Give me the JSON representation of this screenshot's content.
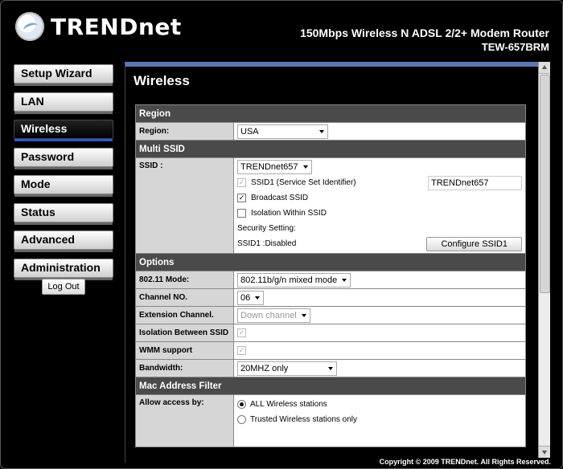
{
  "brand": {
    "name": "TRENDnet"
  },
  "product": {
    "title": "150Mbps Wireless N ADSL 2/2+ Modem Router",
    "model": "TEW-657BRM"
  },
  "nav": {
    "items": [
      "Setup Wizard",
      "LAN",
      "Wireless",
      "Password",
      "Mode",
      "Status",
      "Advanced",
      "Administration"
    ],
    "active": "Wireless",
    "logout": "Log Out"
  },
  "page": {
    "title": "Wireless"
  },
  "region": {
    "header": "Region",
    "label": "Region:",
    "value": "USA"
  },
  "multi_ssid": {
    "header": "Multi SSID",
    "ssid_label": "SSID :",
    "ssid_value": "TRENDnet657",
    "ssid1_label": "SSID1 (Service Set Identifier)",
    "ssid1_value": "TRENDnet657",
    "broadcast_label": "Broadcast SSID",
    "isolation_label": "Isolation Within SSID",
    "security_label": "Security Setting:",
    "security_status": "SSID1 :Disabled",
    "configure_button": "Configure SSID1"
  },
  "options": {
    "header": "Options",
    "mode_label": "802.11 Mode:",
    "mode_value": "802.11b/g/n mixed mode",
    "channel_label": "Channel NO.",
    "channel_value": "06",
    "extension_label": "Extension Channel.",
    "extension_value": "Down channel",
    "isolation_between_label": "Isolation Between SSID",
    "wmm_label": "WMM support",
    "bandwidth_label": "Bandwidth:",
    "bandwidth_value": "20MHZ only"
  },
  "mac_filter": {
    "header": "Mac Address Filter",
    "allow_label": "Allow access by:",
    "option_all": "ALL Wireless stations",
    "option_trusted": "Trusted Wireless stations only"
  },
  "footer": {
    "copyright": "Copyright © 2009 TRENDnet. All Rights Reserved."
  }
}
